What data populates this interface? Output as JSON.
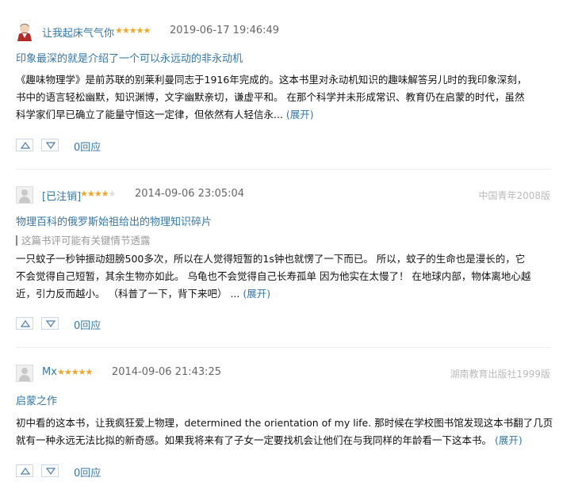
{
  "reviews": [
    {
      "username": "让我起床气气你",
      "stars": "★★★★★",
      "stars_empty": "",
      "time": "2019-06-17 19:46:49",
      "source": "",
      "title": "印象最深的就是介绍了一个可以永远动的非永动机",
      "spoiler": "",
      "lines": [
        "《趣味物理学》是前苏联的别莱利曼同志于1916年完成的。这本书里对永动机知识的趣味解答另儿时的我印象深刻，",
        "书中的语言轻松幽默，知识渊博，文字幽默亲切，谦虚平和。 在那个科学并未形成常识、教育仍在启蒙的时代，虽然",
        "科学家们早已确立了能量守恒这一定律，但依然有人轻信永..."
      ],
      "expand": "(展开)",
      "reply": "0回应",
      "avatar_icon": "user-avatar-photo"
    },
    {
      "username": "[已注销]",
      "stars": "★★★★",
      "stars_empty": "★",
      "time": "2014-09-06 23:05:04",
      "source": "中国青年2008版",
      "title": "物理百科的俄罗斯始祖给出的物理知识碎片",
      "spoiler": "这篇书评可能有关键情节透露",
      "lines": [
        "一只蚊子一秒钟振动翅膀500多次，所以在人觉得短暂的1s钟也就愣了一下而已。 所以，蚊子的生命也是漫长的，它",
        "不会觉得自己短暂，其余生物亦如此。 乌龟也不会觉得自己长寿孤单 因为他实在太慢了！ 在地球内部，物体离地心越",
        "近，引力反而越小。 （科普了一下，背下来吧） ..."
      ],
      "expand": "(展开)",
      "reply": "0回应",
      "avatar_icon": "default-avatar-icon"
    },
    {
      "username": "Mx",
      "stars": "★★★★★",
      "stars_empty": "",
      "time": "2014-09-06 21:43:25",
      "source": "湖南教育出版社1999版",
      "title": "启蒙之作",
      "spoiler": "",
      "lines": [
        "初中看的这本书，让我疯狂爱上物理，determined the orientation of my life. 那时候在学校图书馆发现这本书翻了几页",
        "就有一种永远无法比拟的新奇感。如果我将来有了子女一定要找机会让他们在与我同样的年龄看一下这本书。"
      ],
      "expand": "(展开)",
      "reply": "0回应",
      "avatar_icon": "default-avatar-icon"
    }
  ],
  "icons": {
    "upvote": "upvote-icon",
    "downvote": "downvote-icon"
  },
  "colors": {
    "link": "#3377aa",
    "star": "#f4a521",
    "muted": "#999999"
  }
}
